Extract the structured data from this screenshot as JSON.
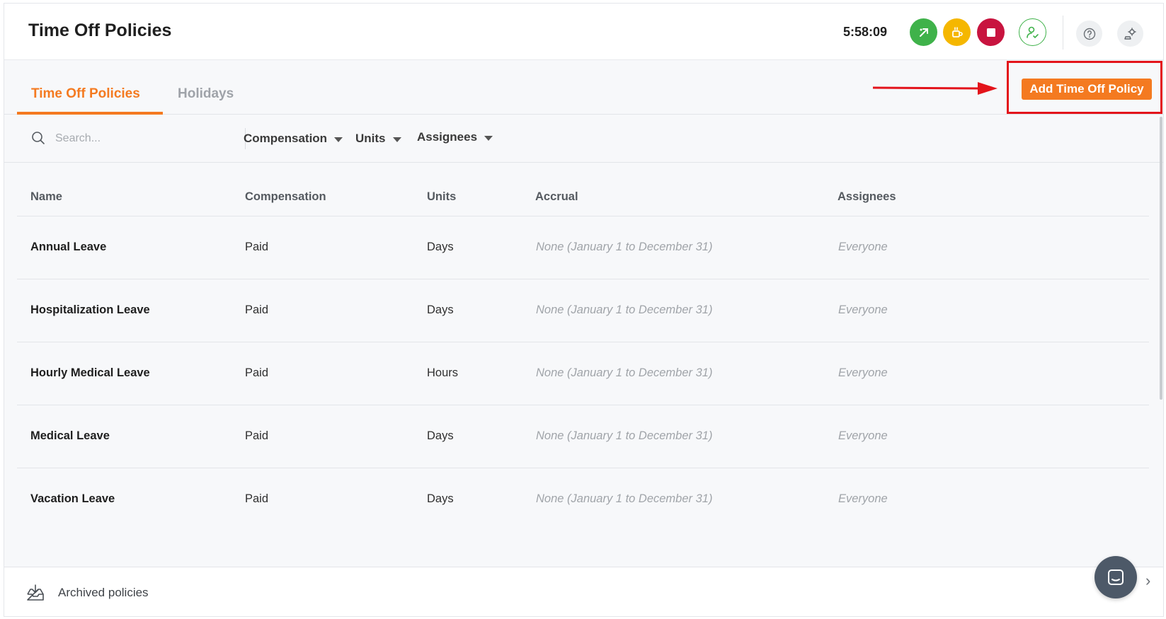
{
  "header": {
    "title": "Time Off Policies",
    "timer": "5:58:09",
    "icons": [
      "clock-out-icon",
      "break-icon",
      "stop-icon",
      "user-status-icon",
      "help-icon",
      "settings-icon"
    ]
  },
  "tabs": [
    {
      "label": "Time Off Policies",
      "active": true
    },
    {
      "label": "Holidays",
      "active": false
    }
  ],
  "actions": {
    "add_policy_label": "Add Time Off Policy"
  },
  "filters": {
    "search_placeholder": "Search...",
    "compensation": "Compensation",
    "units": "Units",
    "assignees": "Assignees"
  },
  "table": {
    "columns": [
      "Name",
      "Compensation",
      "Units",
      "Accrual",
      "Assignees"
    ],
    "rows": [
      {
        "name": "Annual Leave",
        "compensation": "Paid",
        "units": "Days",
        "accrual": "None (January 1 to December 31)",
        "assignees": "Everyone"
      },
      {
        "name": "Hospitalization Leave",
        "compensation": "Paid",
        "units": "Days",
        "accrual": "None (January 1 to December 31)",
        "assignees": "Everyone"
      },
      {
        "name": "Hourly Medical Leave",
        "compensation": "Paid",
        "units": "Hours",
        "accrual": "None (January 1 to December 31)",
        "assignees": "Everyone"
      },
      {
        "name": "Medical Leave",
        "compensation": "Paid",
        "units": "Days",
        "accrual": "None (January 1 to December 31)",
        "assignees": "Everyone"
      },
      {
        "name": "Vacation Leave",
        "compensation": "Paid",
        "units": "Days",
        "accrual": "None (January 1 to December 31)",
        "assignees": "Everyone"
      }
    ]
  },
  "footer": {
    "archived_label": "Archived policies"
  },
  "colors": {
    "accent": "#f47a20",
    "annotation": "#e3141b",
    "green": "#3fb24a",
    "yellow": "#f5b700",
    "red": "#c8143f"
  }
}
